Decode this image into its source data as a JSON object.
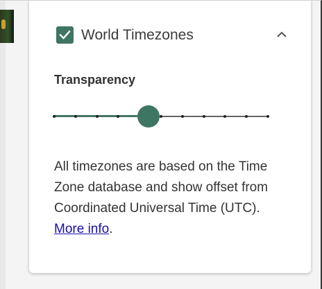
{
  "layer": {
    "title": "World Timezones",
    "enabled": true,
    "expanded": true
  },
  "transparency": {
    "label": "Transparency",
    "value": 0.44,
    "steps": 10
  },
  "description": {
    "text": "All timezones are based on the Time Zone database and show offset from Coordinated Universal Time (UTC). ",
    "link_text": "More info",
    "trailing": "."
  },
  "colors": {
    "accent": "#3f7563",
    "link": "#1a0dab"
  },
  "icons": {
    "checkbox": "check-icon",
    "collapse": "chevron-up-icon"
  }
}
